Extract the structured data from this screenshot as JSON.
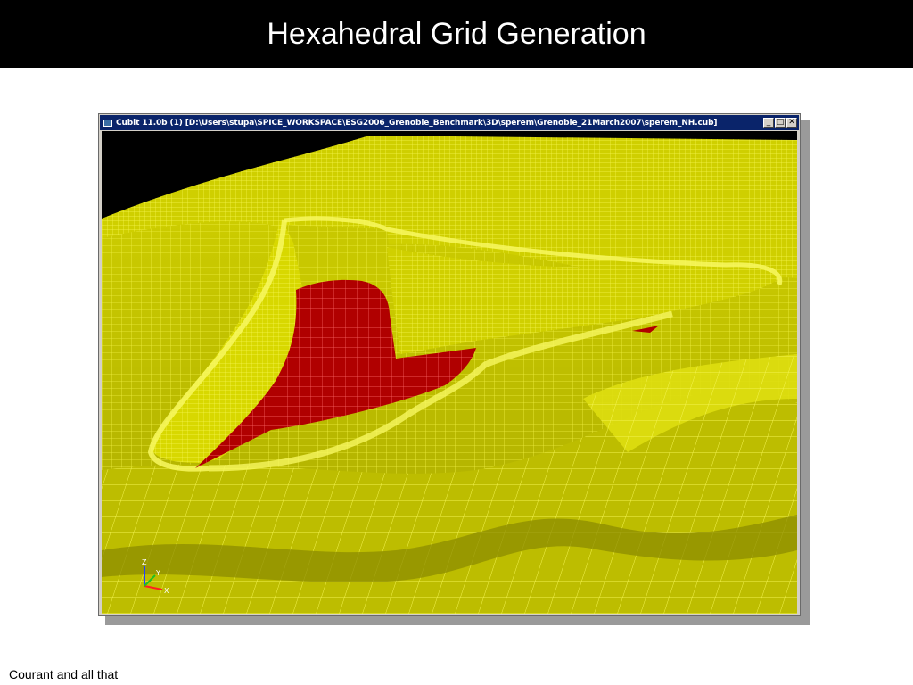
{
  "slide": {
    "title": "Hexahedral Grid Generation",
    "footer": "Courant and all that"
  },
  "window": {
    "title": "Cubit 11.0b (1) [D:\\Users\\stupa\\SPICE_WORKSPACE\\ESG2006_Grenoble_Benchmark\\3D\\sperem\\Grenoble_21March2007\\sperem_NH.cub]",
    "app_icon": "cubit-app-icon",
    "controls": {
      "minimize": "_",
      "maximize": "□",
      "close": "✕"
    }
  },
  "viewport": {
    "background": "#000000",
    "mesh_color": "#d4d400",
    "mesh_light": "#eaea20",
    "mesh_dark": "#8c8c00",
    "highlight_color": "#b00000",
    "triad": {
      "z": "Z",
      "y": "Y",
      "x": "X"
    }
  }
}
